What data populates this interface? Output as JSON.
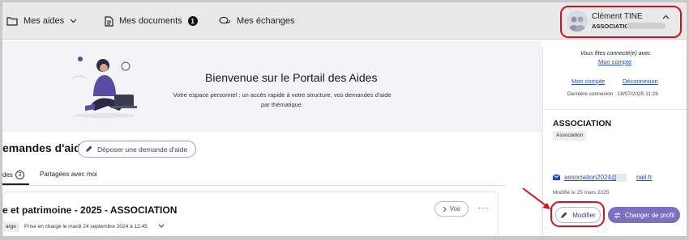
{
  "nav": {
    "aides_label": "Mes aides",
    "documents_label": "Mes documents",
    "documents_count": "1",
    "echanges_label": "Mes échanges"
  },
  "user": {
    "name": "Clément TINE",
    "org": "ASSOCIATION ."
  },
  "welcome": {
    "title": "Bienvenue sur le Portail des Aides",
    "text": "Votre espace personnel : un accès rapide à votre structure, vos demandes d'aide par thématique."
  },
  "demandes": {
    "title": "emandes d'aides",
    "depose_label": "Déposer une demande d'aide",
    "tab_mine_label": "des",
    "tab_mine_count": "3",
    "tab_shared_label": "Partagées avec moi"
  },
  "card": {
    "title": "e et patrimoine - 2025 - ASSOCIATION",
    "voir_label": "Voir",
    "status_tag": "arge",
    "status_text": "Prise en charge le mardi 24 septembre 2024 à 12:45"
  },
  "panel": {
    "connected_text": "Vous êtes connecté(e) avec",
    "connected_link": "Mon compte",
    "mon_compte_link": "Mon compte",
    "deconnexion_link": "Déconnexion",
    "derniere_connexion": "Dernière connexion : 18/07/2025 11:28",
    "org_name": "ASSOCIATION",
    "org_type": "Association",
    "email": "association2024@v",
    "email_suffix": "nail.fr",
    "modified": "Modifié le 25 mars 2025",
    "modifier_label": "Modifier",
    "changer_profil_label": "Changer de profil"
  },
  "colors": {
    "highlight": "#d9101b",
    "link": "#1f4ac9",
    "profile_button": "#7d6fc0"
  }
}
